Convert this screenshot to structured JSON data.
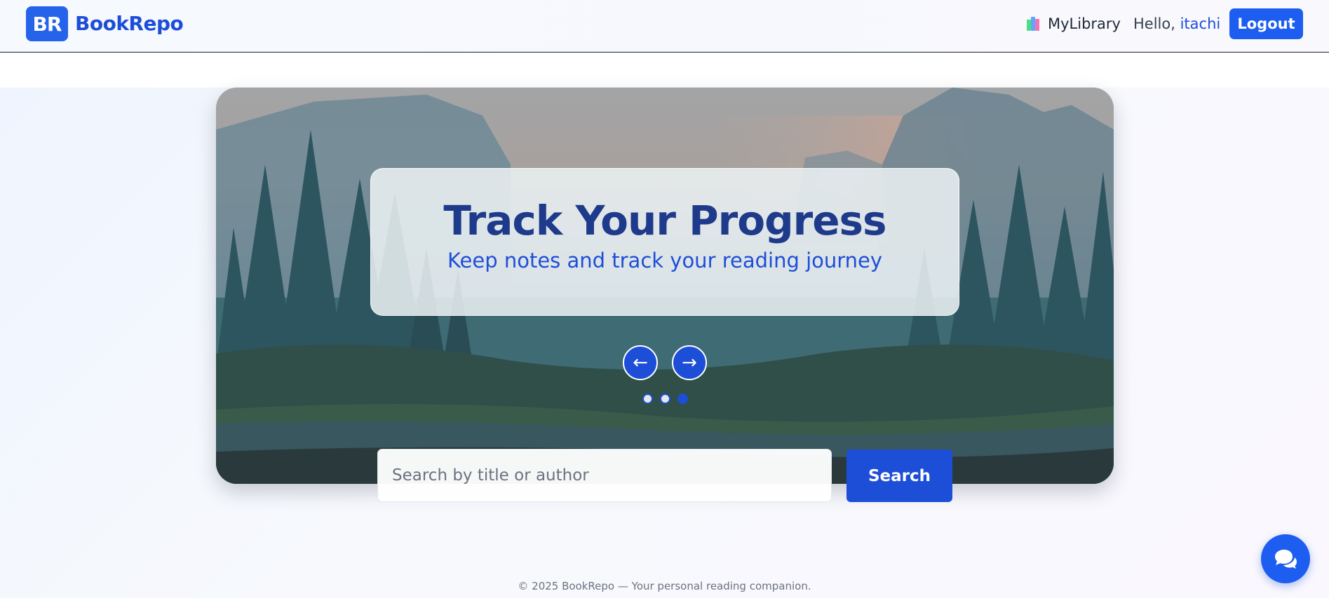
{
  "header": {
    "logo_text": "BR",
    "brand": "BookRepo",
    "library_label": "MyLibrary",
    "greeting_prefix": "Hello,",
    "username": "itachi",
    "logout_label": "Logout"
  },
  "hero": {
    "slide_title": "Track Your Progress",
    "slide_subtitle": "Keep notes and track your reading journey",
    "prev_label": "←",
    "next_label": "→",
    "slide_count": 3,
    "active_slide": 3
  },
  "search": {
    "placeholder": "Search by title or author",
    "button_label": "Search"
  },
  "footer": {
    "text": "© 2025 BookRepo — Your personal reading companion."
  },
  "icons": {
    "library": "books-icon",
    "chat": "chat-icon",
    "prev": "arrow-left-icon",
    "next": "arrow-right-icon"
  },
  "colors": {
    "primary": "#1d4ed8",
    "primary_light": "#2563eb",
    "title": "#1e3a8a"
  }
}
